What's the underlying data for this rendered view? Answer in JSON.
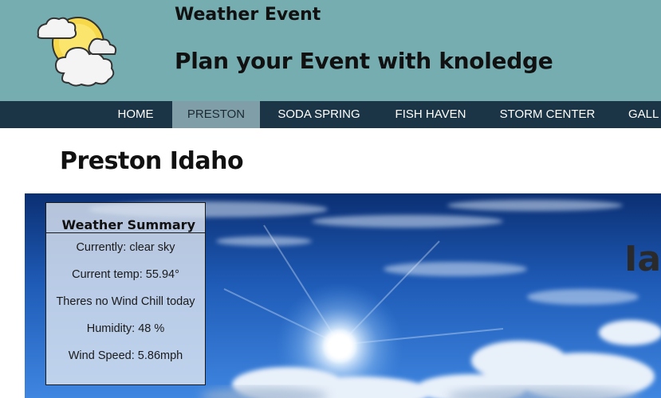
{
  "header": {
    "title": "Weather Event",
    "tagline": "Plan your Event with knoledge",
    "logo_icon": "sun-behind-clouds-icon"
  },
  "nav": {
    "items": [
      {
        "label": "HOME",
        "active": false
      },
      {
        "label": "PRESTON",
        "active": true
      },
      {
        "label": "SODA SPRING",
        "active": false
      },
      {
        "label": "FISH HAVEN",
        "active": false
      },
      {
        "label": "STORM CENTER",
        "active": false
      },
      {
        "label": "GALL",
        "active": false
      }
    ]
  },
  "main": {
    "heading": "Preston Idaho",
    "hero_overlay_text": "Iar"
  },
  "summary": {
    "title": "Weather Summary",
    "currently": "Currently: clear sky",
    "temp": "Current temp: 55.94°",
    "wind_chill": "Theres no Wind Chill today",
    "humidity": "Humidity: 48 %",
    "wind_speed": "Wind Speed: 5.86mph"
  },
  "colors": {
    "header_bg": "#75adb1",
    "nav_bg": "#1b3546",
    "nav_active_bg": "#7f9ea8"
  }
}
